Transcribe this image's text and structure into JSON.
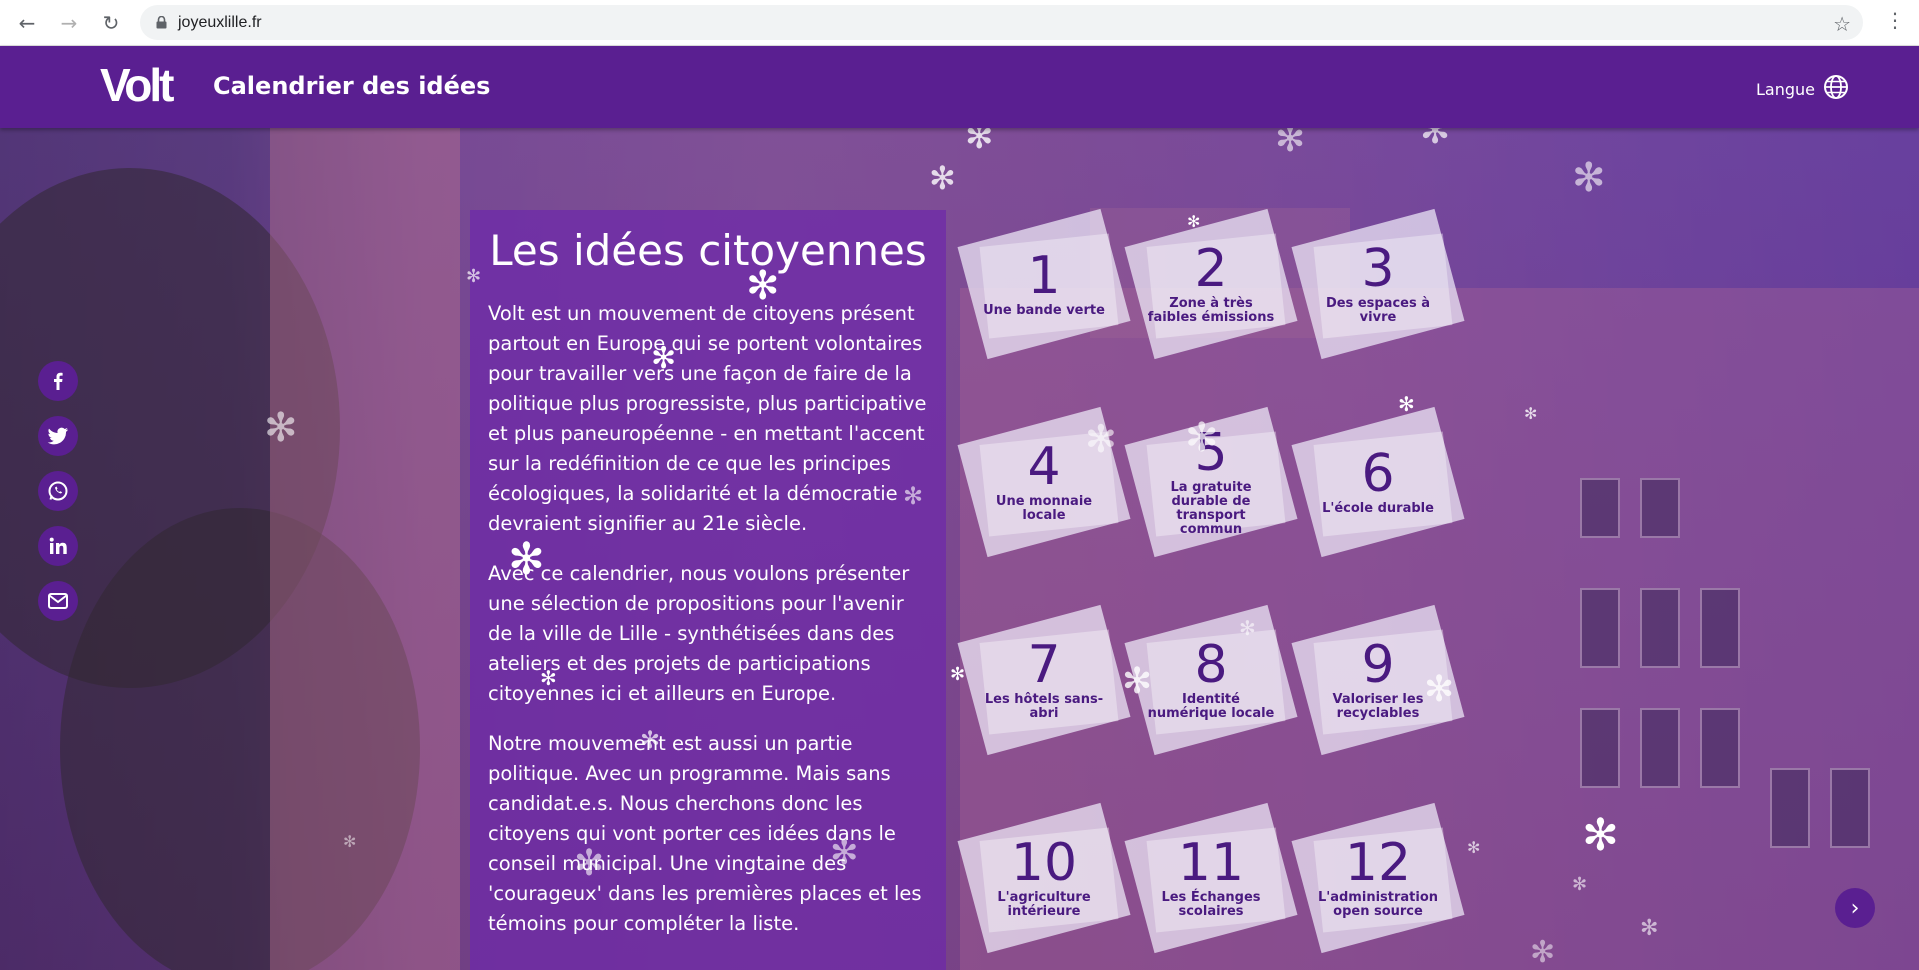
{
  "browser": {
    "url": "joyeuxlille.fr",
    "back_icon": "←",
    "forward_icon": "→",
    "reload_icon": "↻",
    "star_icon": "☆",
    "menu_icon": "⋮"
  },
  "header": {
    "logo": "Volt",
    "title": "Calendrier des idées",
    "language_label": "Langue"
  },
  "intro": {
    "heading": "Les idées citoyennes",
    "paragraphs": [
      "Volt est un mouvement de citoyens présent partout en Europe qui se portent volontaires pour travailler vers une façon de faire de la politique plus progressiste, plus participative et plus paneuropéenne - en mettant l'accent sur la redéfinition de ce que les principes écologiques, la solidarité et la démocratie devraient signifier au 21e siècle.",
      "Avec ce calendrier, nous voulons présenter une sélection de propositions pour l'avenir de la ville de Lille - synthétisées dans des ateliers et des projets de participations citoyennes ici et ailleurs en Europe.",
      "Notre mouvement est aussi un partie politique. Avec un programme. Mais sans candidat.e.s. Nous cherchons donc les citoyens qui vont porter ces idées dans le conseil municipal. Une vingtaine des 'courageux' dans les premières places et les témoins pour compléter la liste."
    ]
  },
  "social": [
    {
      "name": "facebook-icon",
      "glyph": "f"
    },
    {
      "name": "twitter-icon",
      "glyph": "t"
    },
    {
      "name": "whatsapp-icon",
      "glyph": "w"
    },
    {
      "name": "linkedin-icon",
      "glyph": "in"
    },
    {
      "name": "email-icon",
      "glyph": "✉"
    }
  ],
  "calendar": [
    {
      "number": "1",
      "label": "Une bande verte"
    },
    {
      "number": "2",
      "label": "Zone à très faibles émissions"
    },
    {
      "number": "3",
      "label": "Des espaces à vivre"
    },
    {
      "number": "4",
      "label": "Une monnaie locale"
    },
    {
      "number": "5",
      "label": "La gratuite durable de transport commun"
    },
    {
      "number": "6",
      "label": "L'école durable"
    },
    {
      "number": "7",
      "label": "Les hôtels sans-abri"
    },
    {
      "number": "8",
      "label": "Identité numérique locale"
    },
    {
      "number": "9",
      "label": "Valoriser les recyclables"
    },
    {
      "number": "10",
      "label": "L'agriculture intérieure"
    },
    {
      "number": "11",
      "label": "Les Échanges scolaires"
    },
    {
      "number": "12",
      "label": "L'administration open source"
    }
  ],
  "next_icon": "›",
  "colors": {
    "brand_purple": "#5a1f91",
    "door_text": "#4a1a80"
  }
}
